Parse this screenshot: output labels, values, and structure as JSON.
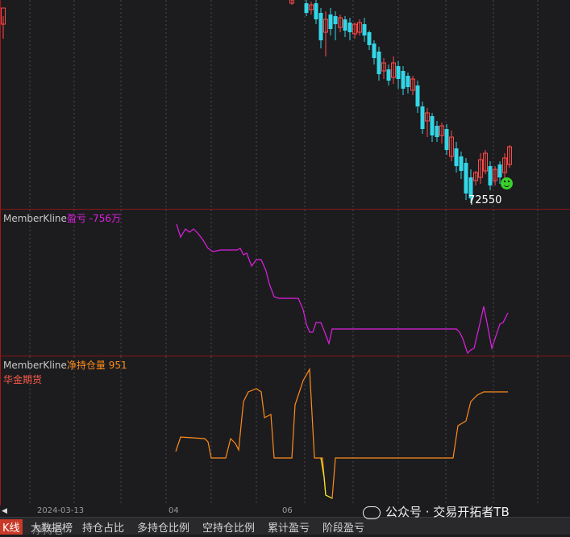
{
  "kline": {
    "last_price_label": "72550",
    "up_color": "#ff4a4a",
    "down_color": "#33d6e6",
    "icon": "smiley-icon"
  },
  "pnl_panel": {
    "indicator": "MemberKline",
    "series": "盈亏",
    "value": "-756万",
    "line_color": "#e020e0"
  },
  "position_panel": {
    "indicator": "MemberKline",
    "series": "净持仓量",
    "value": "951",
    "member": "华金期货",
    "line_color": "#ff8c1a"
  },
  "x_axis": {
    "labels": [
      "2024-03-13",
      "04",
      "06"
    ]
  },
  "tabs": [
    "K线",
    "大数据榜",
    "净持仓",
    "持仓占比",
    "多持仓比例",
    "空持仓比例",
    "累计盈亏",
    "阶段盈亏"
  ],
  "watermark": "公众号 · 交易开拓者TB"
}
